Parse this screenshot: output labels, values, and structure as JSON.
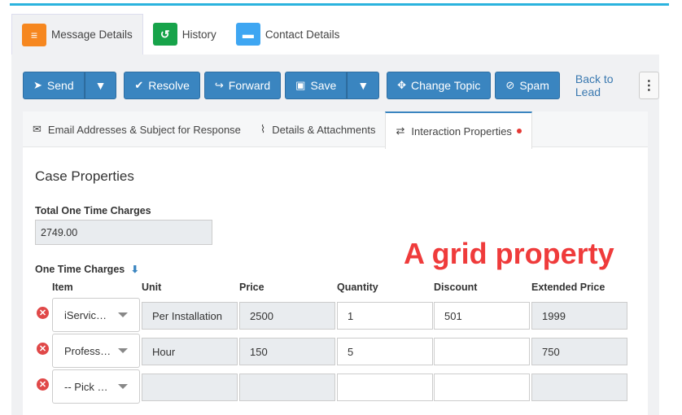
{
  "tabs": [
    {
      "label": "Message Details",
      "icon": "menu-icon"
    },
    {
      "label": "History",
      "icon": "history-icon"
    },
    {
      "label": "Contact Details",
      "icon": "contact-card-icon"
    }
  ],
  "toolbar": {
    "send_label": "Send",
    "resolve_label": "Resolve",
    "forward_label": "Forward",
    "save_label": "Save",
    "change_topic_label": "Change Topic",
    "spam_label": "Spam",
    "back_label": "Back to Lead"
  },
  "subtabs": [
    {
      "label": "Email Addresses & Subject for Response"
    },
    {
      "label": "Details & Attachments"
    },
    {
      "label": "Interaction Properties"
    }
  ],
  "section_title": "Case Properties",
  "total": {
    "label": "Total One Time Charges",
    "value": "2749.00"
  },
  "annotation": "A grid property",
  "grid": {
    "label": "One Time Charges",
    "columns": [
      "Item",
      "Unit",
      "Price",
      "Quantity",
      "Discount",
      "Extended Price"
    ],
    "rows": [
      {
        "item": "iServic…",
        "unit": "Per Installation",
        "price": "2500",
        "quantity": "1",
        "discount": "501",
        "extended": "1999"
      },
      {
        "item": "Profess…",
        "unit": "Hour",
        "price": "150",
        "quantity": "5",
        "discount": "",
        "extended": "750"
      },
      {
        "item": "-- Pick …",
        "unit": "",
        "price": "",
        "quantity": "",
        "discount": "",
        "extended": ""
      }
    ]
  },
  "colors": {
    "accent": "#3a85c0",
    "annotation": "#ef3b3b",
    "remove": "#e04848"
  }
}
